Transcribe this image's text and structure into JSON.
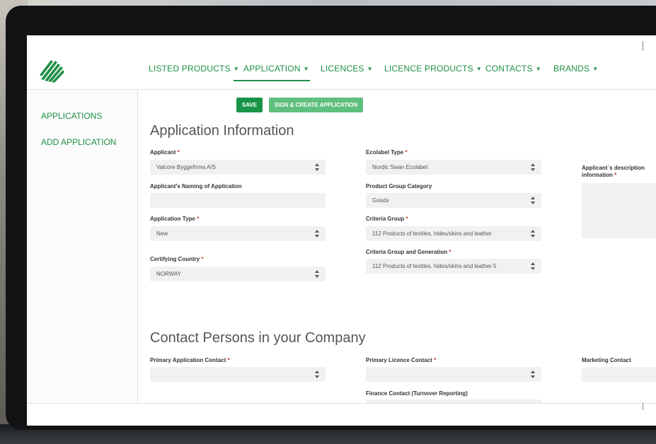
{
  "nav": {
    "items": [
      {
        "label": "LISTED PRODUCTS"
      },
      {
        "label": "APPLICATION"
      },
      {
        "label": "LICENCES"
      },
      {
        "label": "LICENCE PRODUCTS"
      },
      {
        "label": "CONTACTS"
      },
      {
        "label": "BRANDS"
      }
    ],
    "active": "APPLICATION",
    "caret": "▼"
  },
  "sidebar": {
    "items": [
      {
        "label": "APPLICATIONS"
      },
      {
        "label": "ADD APPLICATION"
      }
    ]
  },
  "toolbar": {
    "save_label": "SAVE",
    "sign_label": "SIGN & CREATE APPLICATION"
  },
  "application_info": {
    "title": "Application Information",
    "applicant": {
      "label": "Applicant",
      "value": "Valcore Byggefirma A/S"
    },
    "naming": {
      "label": "Applicant's Naming of Application",
      "value": ""
    },
    "application_type": {
      "label": "Application Type",
      "value": "New"
    },
    "certifying_country": {
      "label": "Certifying Country",
      "value": "NORWAY"
    },
    "ecolabel_type": {
      "label": "Ecolabel Type",
      "value": "Nordic Swan Ecolabel"
    },
    "product_group_category": {
      "label": "Product Group Category",
      "value": "Goods"
    },
    "criteria_group": {
      "label": "Criteria Group",
      "value": "112 Products of textiles, hides/skins and leather"
    },
    "criteria_group_generation": {
      "label": "Criteria Group and Generation",
      "value": "112 Products of textiles, hides/skins and leather 5"
    },
    "description": {
      "label_line1": "Applicant´s description",
      "label_line2": "information"
    }
  },
  "contacts": {
    "title": "Contact Persons in your Company",
    "primary_application_contact": {
      "label": "Primary Application Contact",
      "value": ""
    },
    "primary_licence_contact": {
      "label": "Primary Licence Contact",
      "value": ""
    },
    "marketing_contact": {
      "label": "Marketing Contact",
      "value": ""
    },
    "finance_contact": {
      "label": "Finance Contact (Turnover Reporting)",
      "value": ""
    }
  },
  "required_marker": "*",
  "colors": {
    "accent": "#1f8f46",
    "save": "#199447",
    "sign": "#5fbf7e",
    "required": "#d0342c"
  }
}
